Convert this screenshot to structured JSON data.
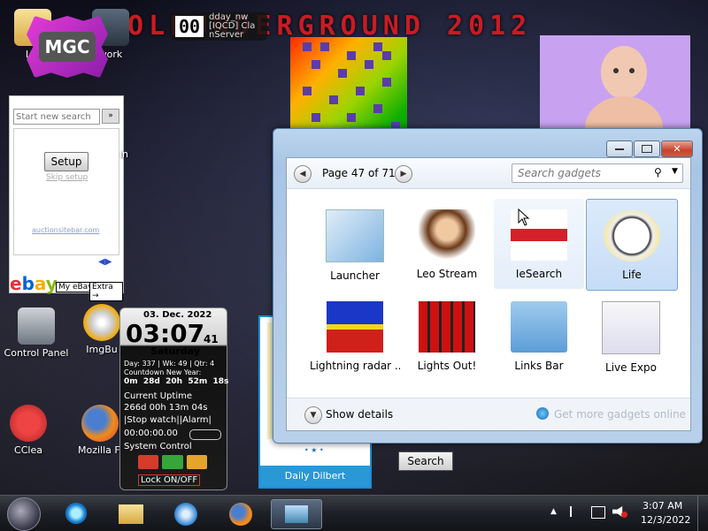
{
  "banner": {
    "text": "WOLDUNDERGROUND 2012"
  },
  "mgc": {
    "label": "MGC"
  },
  "top_clock": {
    "digits": "00",
    "line1": "dday_nw",
    "line2": "[IQCD] Cla",
    "line3": "nServer"
  },
  "desktop_icons": [
    {
      "label": "Lib"
    },
    {
      "label": "work"
    },
    {
      "label": "Control Panel"
    },
    {
      "label": "ImgBu"
    },
    {
      "label": "CClea"
    },
    {
      "label": "Mozilla Fi"
    },
    {
      "label": "in"
    }
  ],
  "search_panel": {
    "placeholder": "Start new search",
    "setup_button": "Setup",
    "skip_link": "Skip setup",
    "footer_link": "auctionsitebar.com",
    "my_ebay": "My eBay",
    "extra": "Extra"
  },
  "window": {
    "page_text": "Page 47 of 71",
    "search_placeholder": "Search gadgets",
    "show_details": "Show details",
    "get_more": "Get more gadgets online",
    "gadgets": [
      {
        "label": "Launcher",
        "state": "normal"
      },
      {
        "label": "Leo Stream",
        "state": "normal"
      },
      {
        "label": "IeSearch",
        "state": "hover"
      },
      {
        "label": "Life",
        "state": "selected"
      },
      {
        "label": "Lightning radar ...",
        "state": "normal"
      },
      {
        "label": "Lights Out!",
        "state": "normal"
      },
      {
        "label": "Links Bar",
        "state": "normal"
      },
      {
        "label": "Live Expo",
        "state": "normal"
      }
    ]
  },
  "clock_gadget": {
    "date": "03. Dec. 2022",
    "time": "03:07",
    "seconds": "41",
    "weekday": "Saturday",
    "info": "Day: 337 | Wk: 49 | Qtr: 4",
    "countdown_label": "Countdown New Year:",
    "countdown": "0m  28d  20h  52m  18s",
    "uptime_label": "Current Uptime",
    "uptime": "266d 00h 13m 04s",
    "stopwatch": "|Stop watch||Alarm|",
    "stopwatch_value": "00:00:00.00",
    "system_control": "System Control",
    "lock": "Lock ON/OFF"
  },
  "dilbert": {
    "label": "Daily Dilbert"
  },
  "search_button": "Search",
  "taskbar": {
    "time": "3:07 AM",
    "date": "12/3/2022"
  }
}
